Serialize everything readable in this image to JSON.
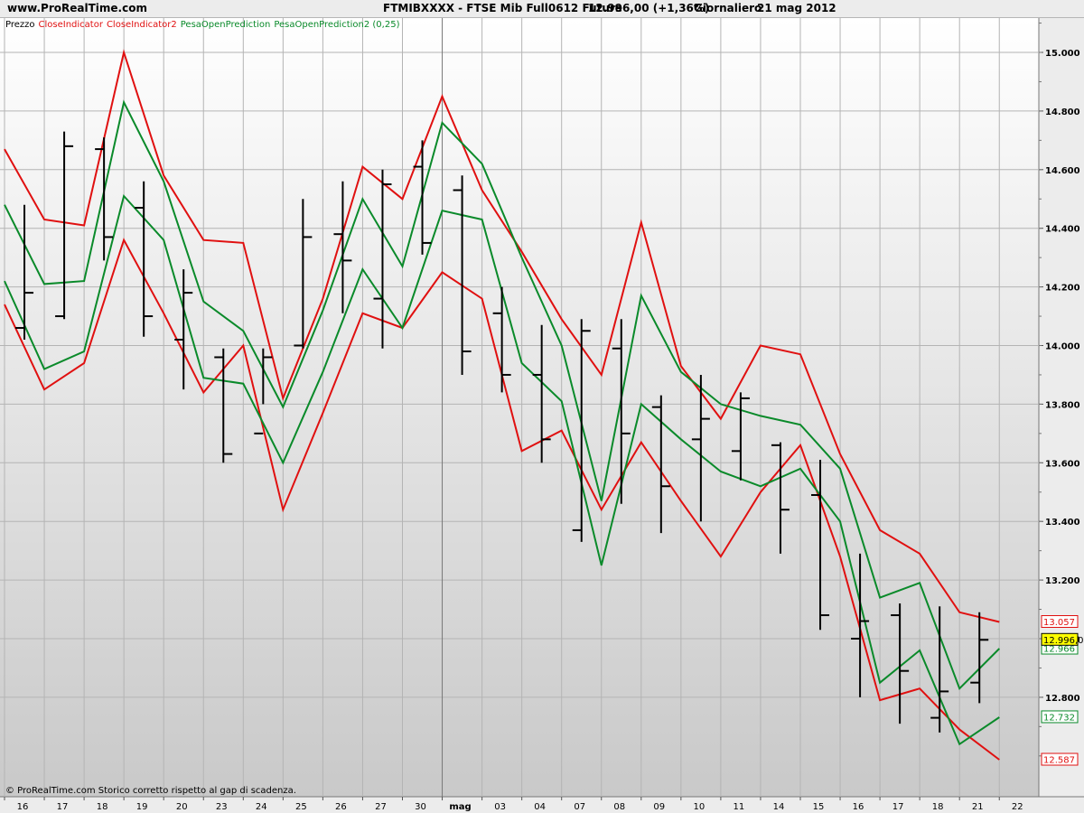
{
  "header": {
    "site": "www.ProRealTime.com",
    "title": "FTMIBXXXX - FTSE Mib Full0612 Future",
    "last_price": "12.996,00 (+1,36%)",
    "period": "Giornaliero",
    "date": "21 mag 2012"
  },
  "legend": {
    "prezzo": "Prezzo",
    "close1": "CloseIndicator",
    "close2": "CloseIndicator2",
    "pesa1": "PesaOpenPrediction",
    "pesa2": "PesaOpenPrediction2 (0,25)"
  },
  "footer": {
    "copyright": "© ProRealTime.com  Storico corretto rispetto al gap di scadenza."
  },
  "colors": {
    "red": "#e01010",
    "green": "#0a8a2a",
    "bar": "#000000",
    "grid": "#b4b4b4",
    "price_tag": "#ffff00"
  },
  "chart_data": {
    "type": "line",
    "y_range": [
      12.5,
      15.2
    ],
    "y_ticks": [
      12.8,
      13.0,
      13.2,
      13.4,
      13.6,
      13.8,
      14.0,
      14.2,
      14.4,
      14.6,
      14.8,
      15.0
    ],
    "y_tick_labels": [
      "12.800",
      "13.000",
      "13.200",
      "13.400",
      "13.600",
      "13.800",
      "14.000",
      "14.200",
      "14.400",
      "14.600",
      "14.800",
      "15.000"
    ],
    "x_labels": [
      "16",
      "17",
      "18",
      "19",
      "20",
      "23",
      "24",
      "25",
      "26",
      "27",
      "30",
      "mag",
      "03",
      "04",
      "07",
      "08",
      "09",
      "10",
      "11",
      "14",
      "15",
      "16",
      "17",
      "18",
      "21",
      "22"
    ],
    "bars": [
      {
        "open": 14.06,
        "high": 14.48,
        "low": 14.02,
        "close": 14.18
      },
      {
        "open": 14.1,
        "high": 14.73,
        "low": 14.09,
        "close": 14.68
      },
      {
        "open": 14.67,
        "high": 14.71,
        "low": 14.29,
        "close": 14.37
      },
      {
        "open": 14.47,
        "high": 14.56,
        "low": 14.03,
        "close": 14.1
      },
      {
        "open": 14.02,
        "high": 14.26,
        "low": 13.85,
        "close": 14.18
      },
      {
        "open": 13.96,
        "high": 13.99,
        "low": 13.6,
        "close": 13.63
      },
      {
        "open": 13.7,
        "high": 13.99,
        "low": 13.8,
        "close": 13.96
      },
      {
        "open": 14.0,
        "high": 14.5,
        "low": 13.99,
        "close": 14.37
      },
      {
        "open": 14.38,
        "high": 14.56,
        "low": 14.11,
        "close": 14.29
      },
      {
        "open": 14.16,
        "high": 14.6,
        "low": 13.99,
        "close": 14.55
      },
      {
        "open": 14.61,
        "high": 14.7,
        "low": 14.31,
        "close": 14.35
      },
      {
        "open": 14.53,
        "high": 14.58,
        "low": 13.9,
        "close": 13.98
      },
      {
        "open": 14.11,
        "high": 14.2,
        "low": 13.84,
        "close": 13.9
      },
      {
        "open": 13.9,
        "high": 14.07,
        "low": 13.6,
        "close": 13.68
      },
      {
        "open": 13.37,
        "high": 14.09,
        "low": 13.33,
        "close": 14.05
      },
      {
        "open": 13.99,
        "high": 14.09,
        "low": 13.46,
        "close": 13.7
      },
      {
        "open": 13.79,
        "high": 13.83,
        "low": 13.36,
        "close": 13.52
      },
      {
        "open": 13.68,
        "high": 13.9,
        "low": 13.4,
        "close": 13.75
      },
      {
        "open": 13.64,
        "high": 13.84,
        "low": 13.54,
        "close": 13.82
      },
      {
        "open": 13.66,
        "high": 13.67,
        "low": 13.29,
        "close": 13.44
      },
      {
        "open": 13.49,
        "high": 13.61,
        "low": 13.03,
        "close": 13.08
      },
      {
        "open": 13.0,
        "high": 13.29,
        "low": 12.8,
        "close": 13.06
      },
      {
        "open": 13.08,
        "high": 13.12,
        "low": 12.71,
        "close": 12.89
      },
      {
        "open": 12.73,
        "high": 13.11,
        "low": 12.68,
        "close": 12.82
      },
      {
        "open": 12.85,
        "high": 13.09,
        "low": 12.78,
        "close": 12.996
      }
    ],
    "series": [
      {
        "name": "CloseIndicator",
        "color": "#e01010",
        "values": [
          14.67,
          14.43,
          14.41,
          15.0,
          14.58,
          14.36,
          14.35,
          13.82,
          14.16,
          14.61,
          14.5,
          14.85,
          14.53,
          14.32,
          14.09,
          13.9,
          14.42,
          13.93,
          13.75,
          14.0,
          13.97,
          13.63,
          13.37,
          13.29,
          13.09,
          13.057
        ]
      },
      {
        "name": "CloseIndicator2",
        "color": "#e01010",
        "values": [
          14.14,
          13.85,
          13.94,
          14.36,
          14.11,
          13.84,
          14.0,
          13.44,
          13.77,
          14.11,
          14.06,
          14.25,
          14.16,
          13.64,
          13.71,
          13.44,
          13.67,
          13.47,
          13.28,
          13.5,
          13.66,
          13.28,
          12.79,
          12.83,
          12.69,
          12.587
        ]
      },
      {
        "name": "PesaOpenPrediction",
        "color": "#0a8a2a",
        "values": [
          14.48,
          14.21,
          14.22,
          14.83,
          14.56,
          14.15,
          14.05,
          13.79,
          14.12,
          14.5,
          14.27,
          14.76,
          14.62,
          14.3,
          14.0,
          13.47,
          14.17,
          13.91,
          13.8,
          13.76,
          13.73,
          13.58,
          13.14,
          13.19,
          12.83,
          12.966
        ]
      },
      {
        "name": "PesaOpenPrediction2 (0,25)",
        "color": "#0a8a2a",
        "values": [
          14.22,
          13.92,
          13.98,
          14.51,
          14.36,
          13.89,
          13.87,
          13.6,
          13.91,
          14.26,
          14.06,
          14.46,
          14.43,
          13.94,
          13.81,
          13.25,
          13.8,
          13.68,
          13.57,
          13.52,
          13.58,
          13.4,
          12.85,
          12.96,
          12.64,
          12.732
        ]
      }
    ],
    "value_tags": [
      {
        "label": "13.057",
        "value": 13.057,
        "color": "#e01010",
        "bg": "#ffffff"
      },
      {
        "label": "12.966",
        "value": 12.966,
        "color": "#0a8a2a",
        "bg": "#ffffff"
      },
      {
        "label": "12.996,0",
        "value": 12.996,
        "color": "#000000",
        "bg": "#ffff00"
      },
      {
        "label": "12.732",
        "value": 12.732,
        "color": "#0a8a2a",
        "bg": "#ffffff"
      },
      {
        "label": "12.587",
        "value": 12.587,
        "color": "#e01010",
        "bg": "#ffffff"
      }
    ],
    "grid": true
  }
}
